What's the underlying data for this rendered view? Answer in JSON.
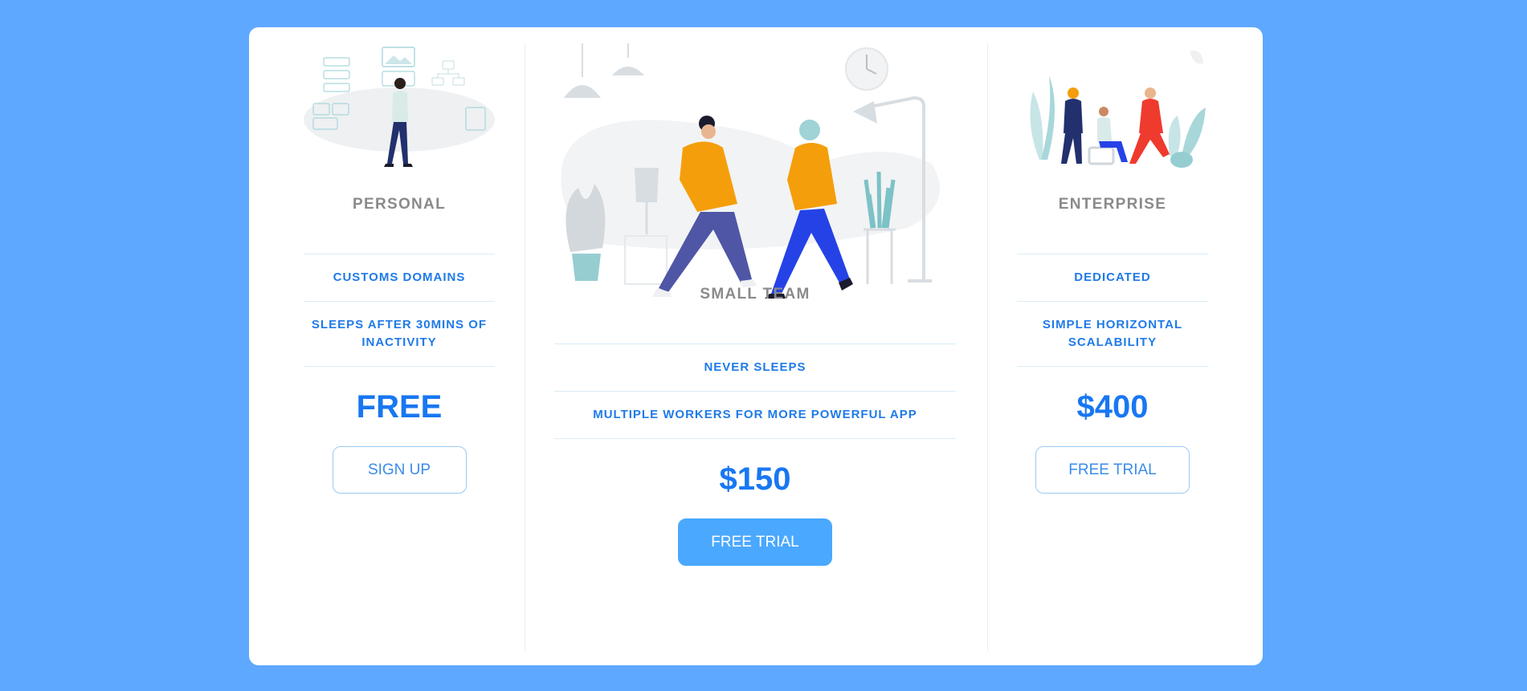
{
  "colors": {
    "page_background": "#5fa8ff",
    "card_background": "#ffffff",
    "accent_blue": "#1877f2",
    "title_gray": "#8a8a8a",
    "primary_button": "#4aa8ff"
  },
  "plans": [
    {
      "title": "PERSONAL",
      "illustration": "person-walking-with-dashboard-illustration",
      "features": [
        "CUSTOMS DOMAINS",
        "SLEEPS AFTER 30MINS OF INACTIVITY"
      ],
      "price": "FREE",
      "button": "SIGN UP"
    },
    {
      "title": "SMALL TEAM",
      "illustration": "two-people-walking-illustration",
      "features": [
        "NEVER SLEEPS",
        "MULTIPLE WORKERS FOR MORE POWERFUL APP"
      ],
      "price": "$150",
      "button": "FREE TRIAL"
    },
    {
      "title": "ENTERPRISE",
      "illustration": "team-meeting-illustration",
      "features": [
        "DEDICATED",
        "SIMPLE HORIZONTAL SCALABILITY"
      ],
      "price": "$400",
      "button": "FREE TRIAL"
    }
  ]
}
